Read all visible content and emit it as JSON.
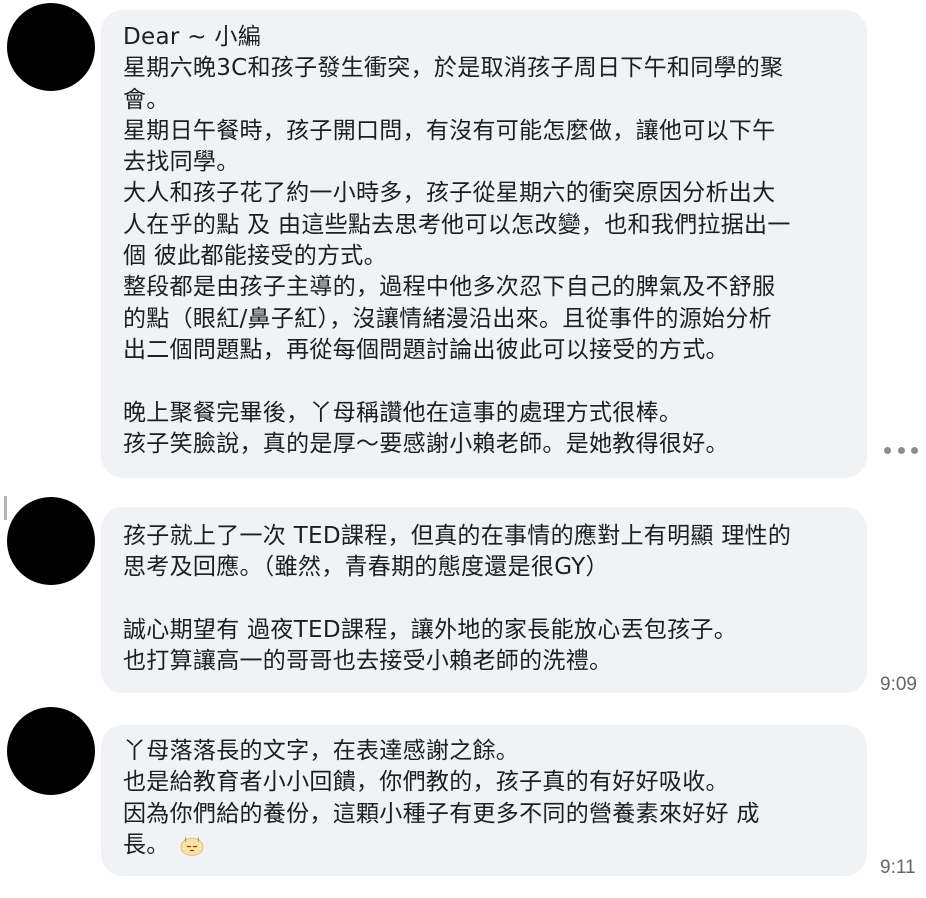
{
  "messages": [
    {
      "lines": [
        "Dear ~ 小編",
        "星期六晚3C和孩子發生衝突，於是取消孩子周日下午和同學的聚",
        "會。",
        "星期日午餐時，孩子開口問，有沒有可能怎麼做，讓他可以下午",
        "去找同學。",
        "大人和孩子花了約一小時多，孩子從星期六的衝突原因分析出大",
        "人在乎的點 及 由這些點去思考他可以怎改變，也和我們拉据出一",
        "個 彼此都能接受的方式。",
        "整段都是由孩子主導的，過程中他多次忍下自己的脾氣及不舒服",
        "的點（眼紅/鼻子紅），沒讓情緒漫沿出來。且從事件的源始分析",
        "出二個問題點，再從每個問題討論出彼此可以接受的方式。",
        "",
        "晚上聚餐完畢後，丫母稱讚他在這事的處理方式很棒。",
        "孩子笑臉說，真的是厚～要感謝小賴老師。是她教得很好。"
      ]
    },
    {
      "lines": [
        "孩子就上了一次 TED課程，但真的在事情的應對上有明顯 理性的",
        "思考及回應。（雖然，青春期的態度還是很GY）",
        "",
        "誠心期望有 過夜TED課程，讓外地的家長能放心丟包孩子。",
        "也打算讓高一的哥哥也去接受小賴老師的洗禮。"
      ],
      "time": "9:09"
    },
    {
      "lines": [
        "丫母落落長的文字，在表達感謝之餘。",
        "也是給教育者小小回饋，你們教的，孩子真的有好好吸收。",
        "因為你們給的養份，這顆小種子有更多不同的營養素來好好 成",
        "長。"
      ],
      "time": "9:11",
      "emoji_icon": "relieved-face-emoji"
    }
  ],
  "colors": {
    "bubble": "#f0f2f5",
    "text": "#1c1e21",
    "timestamp": "#65676b",
    "avatar": "#000000"
  }
}
